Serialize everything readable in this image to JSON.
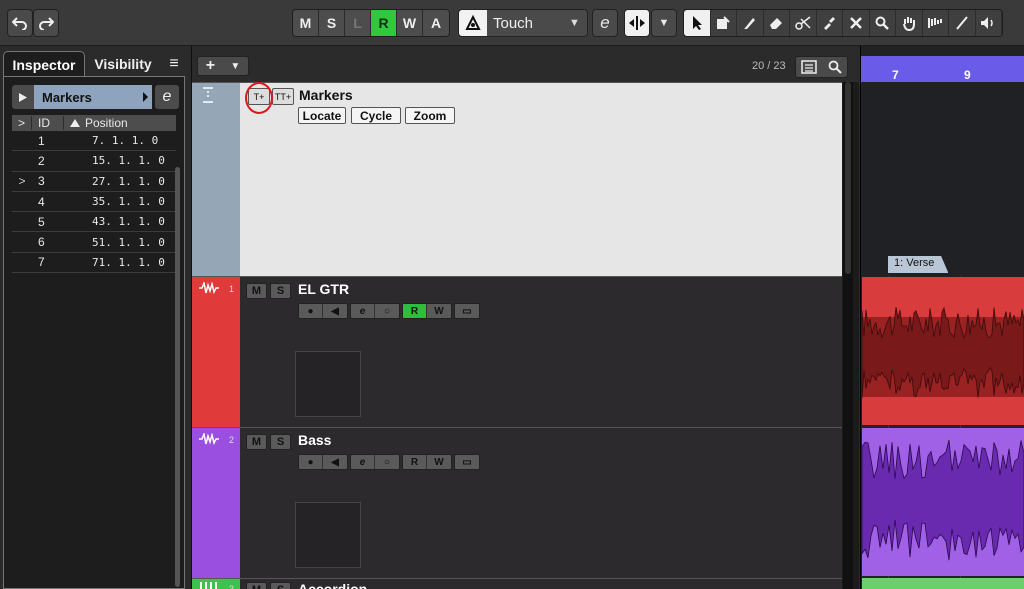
{
  "toolbar": {
    "undo_icon": "undo-icon",
    "redo_icon": "redo-icon",
    "modes": [
      {
        "label": "M",
        "state": "normal"
      },
      {
        "label": "S",
        "state": "normal"
      },
      {
        "label": "L",
        "state": "dim"
      },
      {
        "label": "R",
        "state": "on"
      },
      {
        "label": "W",
        "state": "normal"
      },
      {
        "label": "A",
        "state": "normal"
      }
    ],
    "automation_mode": "Touch",
    "tools": [
      "pointer-icon",
      "range-icon",
      "pencil-icon",
      "eraser-icon",
      "scissors-icon",
      "glue-icon",
      "mute-icon",
      "zoom-icon",
      "hand-icon",
      "comp-icon",
      "line-icon",
      "speaker-icon"
    ]
  },
  "inspector": {
    "tab_active": "Inspector",
    "tab_inactive": "Visibility",
    "menu_icon": "≡",
    "markers_title": "Markers",
    "columns": {
      "expand": ">",
      "id": "ID",
      "position": "Position"
    },
    "markers": [
      {
        "id": "1",
        "position": "7. 1. 1.   0",
        "current": false
      },
      {
        "id": "2",
        "position": "15. 1. 1.   0",
        "current": false
      },
      {
        "id": "3",
        "position": "27. 1. 1.   0",
        "current": true
      },
      {
        "id": "4",
        "position": "35. 1. 1.   0",
        "current": false
      },
      {
        "id": "5",
        "position": "43. 1. 1.   0",
        "current": false
      },
      {
        "id": "6",
        "position": "51. 1. 1.   0",
        "current": false
      },
      {
        "id": "7",
        "position": "71. 1. 1.   0",
        "current": false
      }
    ]
  },
  "tracklist": {
    "add_label": "+",
    "count": "20 / 23",
    "marker_track": {
      "name": "Markers",
      "buttons": [
        "Locate",
        "Cycle",
        "Zoom"
      ]
    },
    "tracks": [
      {
        "num": "1",
        "name": "EL GTR",
        "color": "#e03a3a",
        "read_on": true
      },
      {
        "num": "2",
        "name": "Bass",
        "color": "#9b4fe0",
        "read_on": false
      },
      {
        "num": "3",
        "name": "Accordion",
        "color": "#3ec24a",
        "read_on": false
      }
    ],
    "mute_label": "M",
    "solo_label": "S",
    "read_label": "R",
    "write_label": "W"
  },
  "project": {
    "ruler_marks": [
      "7",
      "9"
    ],
    "marker_label": "1: Verse"
  }
}
